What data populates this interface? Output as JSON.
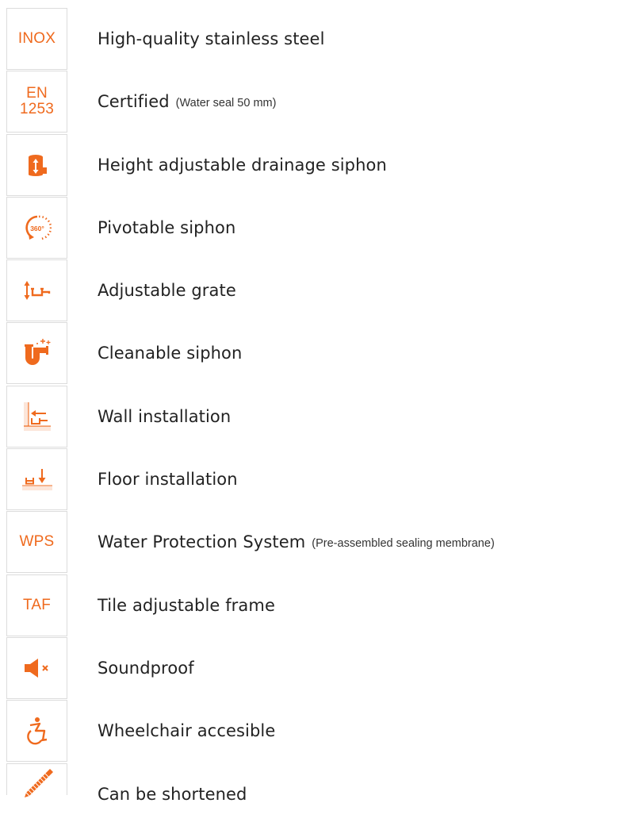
{
  "accent_color": "#ef6a1e",
  "features": [
    {
      "icon_name": "inox-text-icon",
      "icon_text": "INOX",
      "title": "High-quality stainless steel",
      "note": ""
    },
    {
      "icon_name": "en-1253-certification-icon",
      "icon_text_line1": "EN",
      "icon_text_line2": "1253",
      "title": "Certified",
      "note": "(Water seal 50 mm)"
    },
    {
      "icon_name": "height-adjustable-siphon-icon",
      "title": "Height adjustable drainage siphon",
      "note": ""
    },
    {
      "icon_name": "pivot-360-icon",
      "icon_text": "360°",
      "title": "Pivotable siphon",
      "note": ""
    },
    {
      "icon_name": "adjustable-grate-icon",
      "title": "Adjustable grate",
      "note": ""
    },
    {
      "icon_name": "cleanable-siphon-icon",
      "title": "Cleanable siphon",
      "note": ""
    },
    {
      "icon_name": "wall-installation-icon",
      "title": "Wall installation",
      "note": ""
    },
    {
      "icon_name": "floor-installation-icon",
      "title": "Floor installation",
      "note": ""
    },
    {
      "icon_name": "wps-text-icon",
      "icon_text": "WPS",
      "title": "Water Protection System",
      "note": "(Pre-assembled sealing membrane)"
    },
    {
      "icon_name": "taf-text-icon",
      "icon_text": "TAF",
      "title": "Tile adjustable frame",
      "note": ""
    },
    {
      "icon_name": "soundproof-speaker-mute-icon",
      "title": "Soundproof",
      "note": ""
    },
    {
      "icon_name": "wheelchair-icon",
      "title": "Wheelchair accesible",
      "note": ""
    },
    {
      "icon_name": "saw-icon",
      "title": "Can be shortened",
      "note": ""
    }
  ]
}
